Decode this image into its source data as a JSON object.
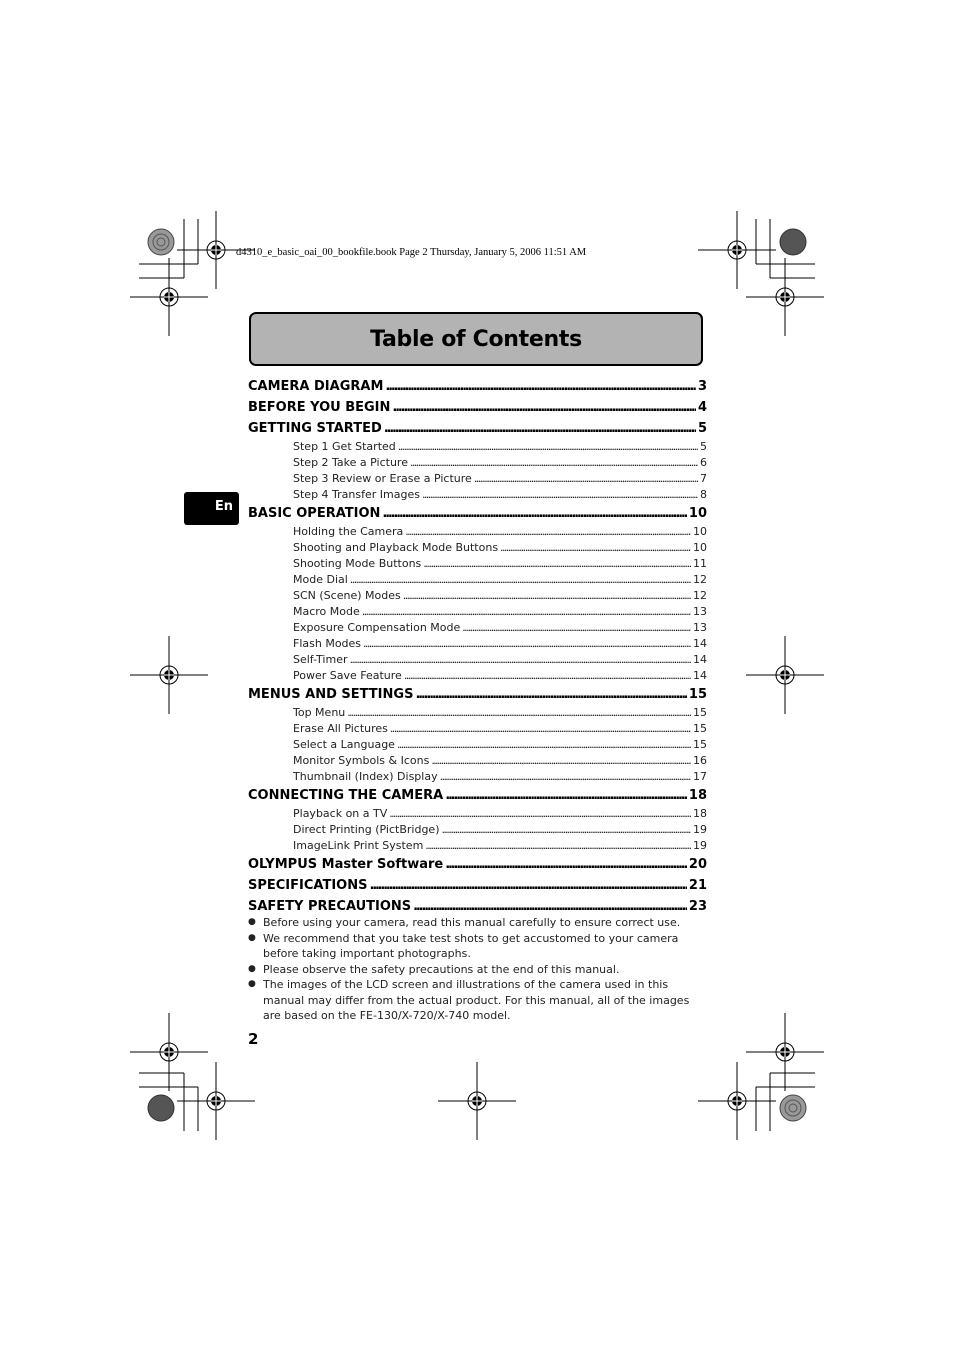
{
  "print_header": "d4310_e_basic_oai_00_bookfile.book  Page 2  Thursday, January 5, 2006  11:51 AM",
  "title": "Table of Contents",
  "language_tab": "En",
  "toc": [
    {
      "label": "CAMERA DIAGRAM",
      "page": "3",
      "level": 1
    },
    {
      "label": "BEFORE YOU BEGIN",
      "page": "4",
      "level": 1
    },
    {
      "label": "GETTING STARTED",
      "page": "5",
      "level": 1
    },
    {
      "label": "Step 1 Get Started",
      "page": "5",
      "level": 2
    },
    {
      "label": "Step 2 Take a Picture",
      "page": "6",
      "level": 2
    },
    {
      "label": "Step 3 Review or Erase a Picture",
      "page": "7",
      "level": 2
    },
    {
      "label": "Step 4 Transfer Images",
      "page": "8",
      "level": 2
    },
    {
      "label": "BASIC OPERATION",
      "page": "10",
      "level": 1
    },
    {
      "label": "Holding the Camera",
      "page": "10",
      "level": 2
    },
    {
      "label": "Shooting and Playback Mode Buttons",
      "page": "10",
      "level": 2
    },
    {
      "label": "Shooting Mode Buttons",
      "page": "11",
      "level": 2
    },
    {
      "label": "Mode Dial",
      "page": "12",
      "level": 2
    },
    {
      "label": "SCN (Scene) Modes",
      "page": "12",
      "level": 2
    },
    {
      "label": "Macro Mode",
      "page": "13",
      "level": 2
    },
    {
      "label": "Exposure Compensation Mode",
      "page": "13",
      "level": 2
    },
    {
      "label": "Flash Modes",
      "page": "14",
      "level": 2
    },
    {
      "label": "Self-Timer",
      "page": "14",
      "level": 2
    },
    {
      "label": "Power Save Feature",
      "page": "14",
      "level": 2
    },
    {
      "label": "MENUS AND SETTINGS",
      "page": "15",
      "level": 1
    },
    {
      "label": "Top Menu",
      "page": "15",
      "level": 2
    },
    {
      "label": "Erase All Pictures",
      "page": "15",
      "level": 2
    },
    {
      "label": "Select a Language",
      "page": "15",
      "level": 2
    },
    {
      "label": "Monitor Symbols & Icons",
      "page": "16",
      "level": 2
    },
    {
      "label": "Thumbnail (Index) Display",
      "page": "17",
      "level": 2
    },
    {
      "label": "CONNECTING THE CAMERA",
      "page": "18",
      "level": 1
    },
    {
      "label": "Playback on a TV",
      "page": "18",
      "level": 2
    },
    {
      "label": "Direct Printing (PictBridge)",
      "page": "19",
      "level": 2
    },
    {
      "label": "ImageLink Print System",
      "page": "19",
      "level": 2
    },
    {
      "label": "OLYMPUS Master Software",
      "page": "20",
      "level": 1
    },
    {
      "label": "SPECIFICATIONS",
      "page": "21",
      "level": 1
    },
    {
      "label": "SAFETY PRECAUTIONS",
      "page": "23",
      "level": 1
    }
  ],
  "notes": [
    {
      "bullet": "●",
      "text": "Before using your camera, read this manual carefully to ensure correct use."
    },
    {
      "bullet": "●",
      "text": "We recommend that you take test shots to get accustomed to your camera before taking important photographs."
    },
    {
      "bullet": "●",
      "text": "Please observe the safety precautions at the end of this manual."
    },
    {
      "bullet": "●",
      "text": "The images of the LCD screen and illustrations of the camera used in this manual may differ from the actual product. For this manual, all of the images are based on the FE-130/X-720/X-740 model."
    }
  ],
  "page_number": "2"
}
